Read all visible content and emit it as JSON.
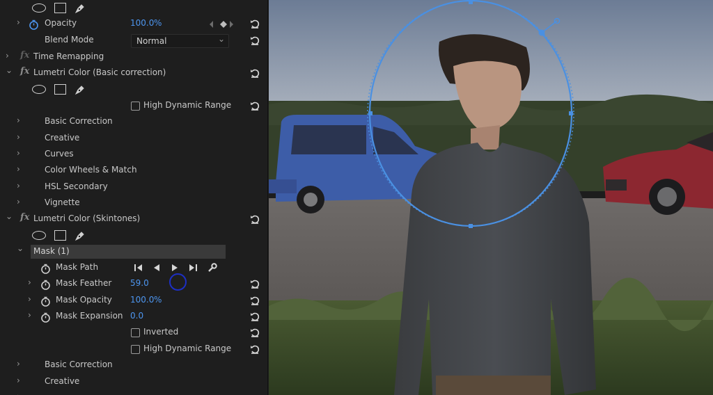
{
  "effects_panel": {
    "opacity": {
      "label": "Opacity",
      "value": "100.0",
      "unit": "%"
    },
    "blend_mode": {
      "label": "Blend Mode",
      "value": "Normal"
    },
    "time_remapping": {
      "label": "Time Remapping"
    },
    "lumetri_basic": {
      "title": "Lumetri Color (Basic correction)",
      "hdr_label": "High Dynamic Range",
      "sections": [
        "Basic Correction",
        "Creative",
        "Curves",
        "Color Wheels & Match",
        "HSL Secondary",
        "Vignette"
      ]
    },
    "lumetri_skin": {
      "title": "Lumetri Color (Skintones)",
      "mask": {
        "title": "Mask (1)",
        "path_label": "Mask Path",
        "feather": {
          "label": "Mask Feather",
          "value": "59.0"
        },
        "opacity": {
          "label": "Mask Opacity",
          "value": "100.0",
          "unit": "%"
        },
        "expansion": {
          "label": "Mask Expansion",
          "value": "0.0"
        },
        "inverted_label": "Inverted",
        "hdr_label": "High Dynamic Range"
      },
      "sections": [
        "Basic Correction",
        "Creative"
      ]
    }
  },
  "icons": {
    "chevron_right": "›",
    "chevron_down": "⌄",
    "fx": "fx",
    "dropdown_chevron": "⌄"
  },
  "colors": {
    "accent_value": "#4d96f0",
    "mask_stroke": "#4a90e2"
  }
}
